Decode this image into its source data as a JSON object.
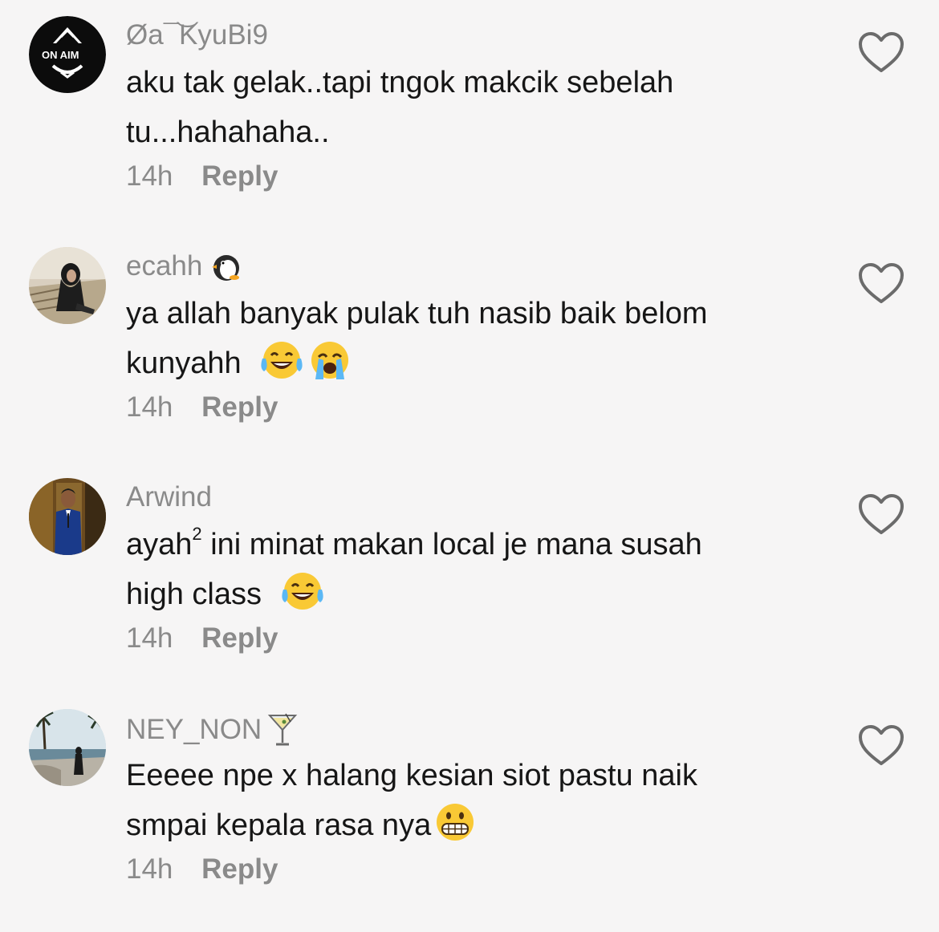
{
  "comments": [
    {
      "username": "Øa¯͝KyuBi9",
      "text_lines": [
        "aku tak gelak..tapi tngok makcik sebelah",
        "tu...hahahaha.."
      ],
      "time": "14h",
      "reply_label": "Reply",
      "avatar": "on-aim-logo-avatar"
    },
    {
      "username": "ecahh",
      "username_emoji": "penguin-icon",
      "text_lines": [
        "ya allah banyak pulak tuh nasib baik belom",
        "kunyahh"
      ],
      "line2_emojis": [
        "laughing-tears-emoji",
        "crying-emoji"
      ],
      "time": "14h",
      "reply_label": "Reply",
      "avatar": "woman-in-hijab-avatar"
    },
    {
      "username": "Arwind",
      "text_line1_prefix": "ayah",
      "text_line1_sup": "2",
      "text_line1_suffix": " ini minat makan local je mana susah",
      "text_line2": "high class",
      "line2_emojis": [
        "laughing-tears-emoji"
      ],
      "time": "14h",
      "reply_label": "Reply",
      "avatar": "man-in-blue-suit-avatar"
    },
    {
      "username": "NEY_NON",
      "username_emoji": "cocktail-glass-icon",
      "text_lines": [
        "Eeeee npe x halang kesian siot pastu naik",
        "smpai kepala rasa nya"
      ],
      "line2_emojis": [
        "grimacing-emoji"
      ],
      "time": "14h",
      "reply_label": "Reply",
      "avatar": "beach-avatar"
    }
  ],
  "colors": {
    "background": "#f6f5f5",
    "text": "#161616",
    "secondary": "#8a8a8a",
    "heart_outline": "#6b6b6b"
  }
}
